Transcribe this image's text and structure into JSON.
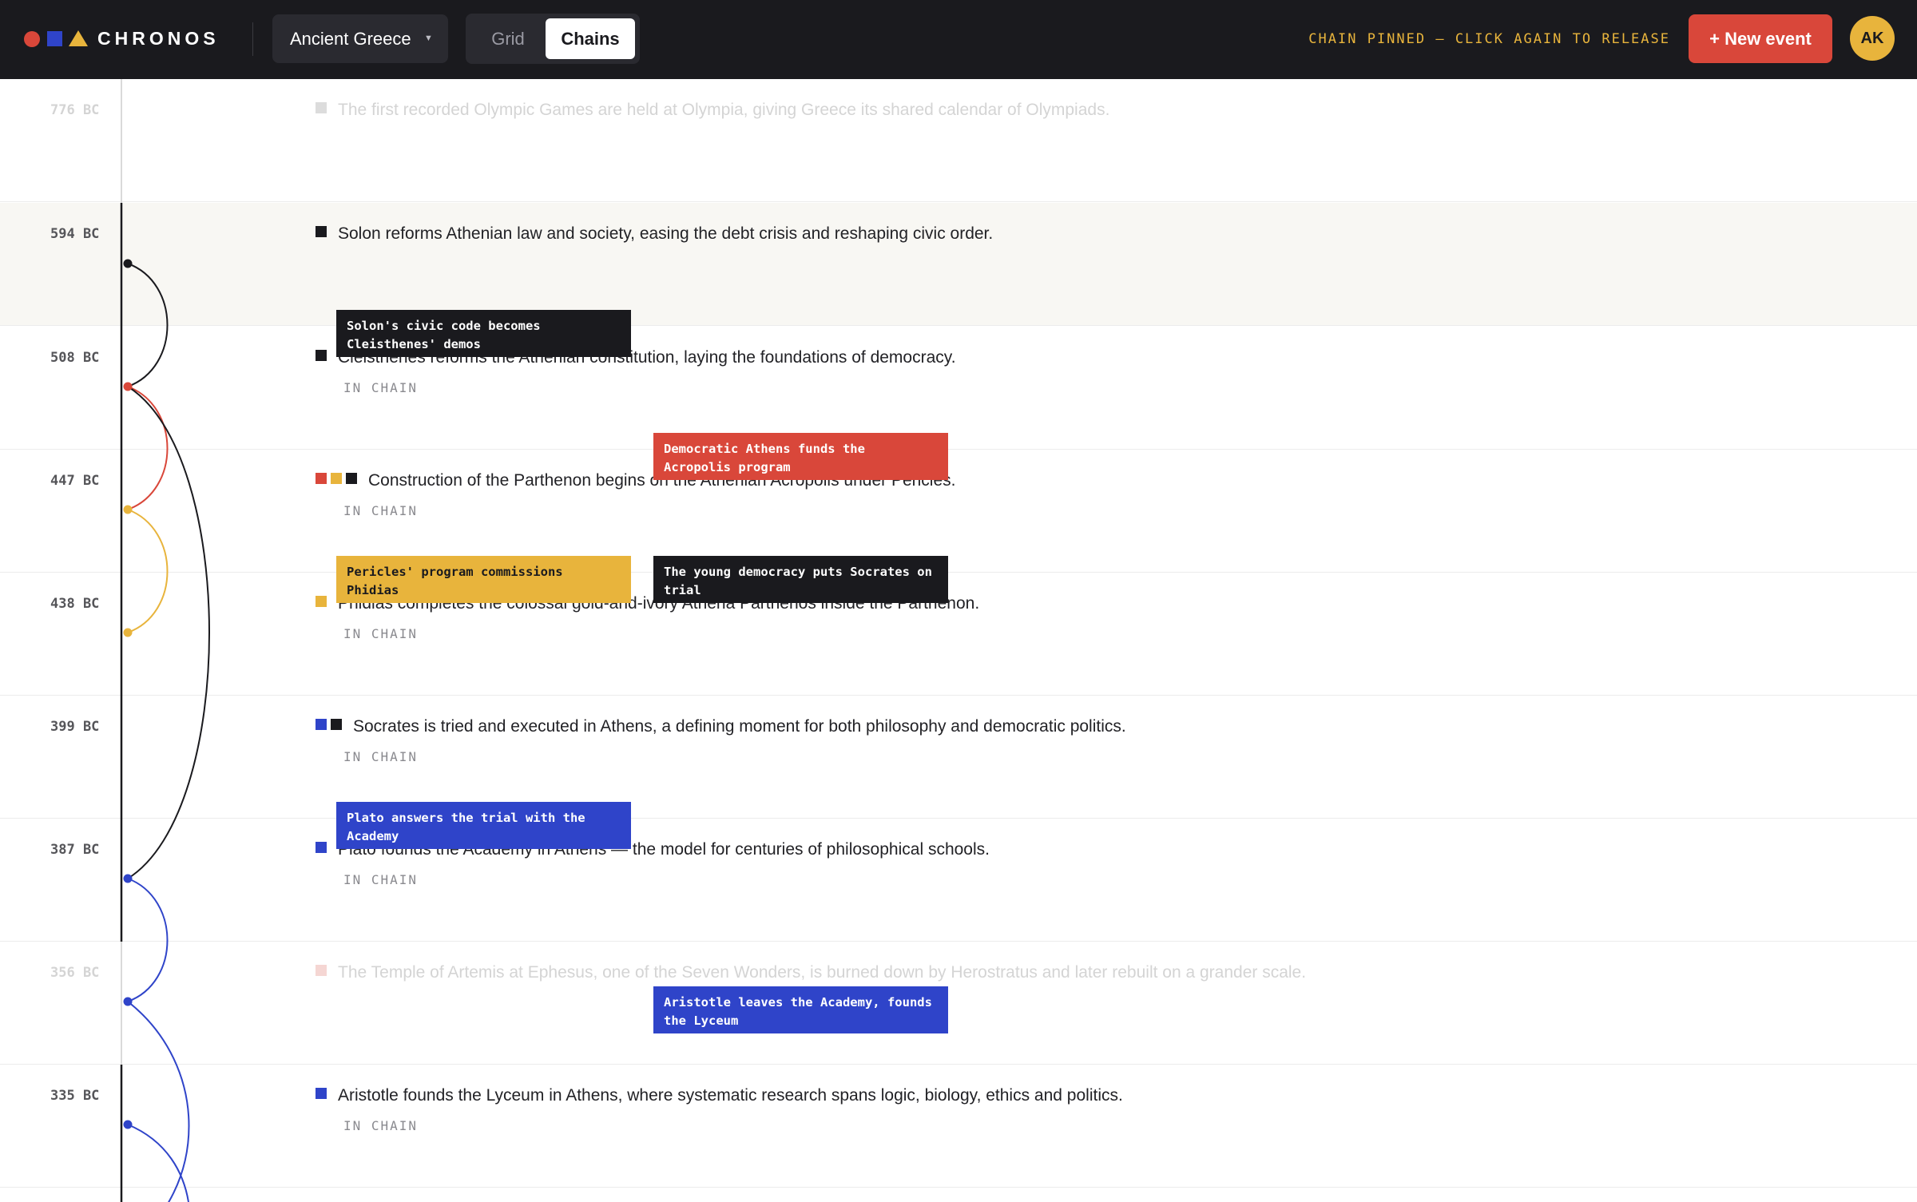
{
  "header": {
    "brand": "CHRONOS",
    "project": "Ancient Greece",
    "tabs": {
      "grid": "Grid",
      "chains": "Chains"
    },
    "status": "CHAIN PINNED — CLICK AGAIN TO RELEASE",
    "new_event": "+ New event",
    "avatar_initials": "AK"
  },
  "colors": {
    "red": "#d9473a",
    "yellow": "#e8b43c",
    "blue": "#2f44c9",
    "black": "#1a1a1e"
  },
  "events": [
    {
      "year": "776 BC",
      "text": "The first recorded Olympic Games are held at Olympia, giving Greece its shared calendar of Olympiads.",
      "in_chain": false
    },
    {
      "year": "594 BC",
      "text": "Solon reforms Athenian law and society, easing the debt crisis and reshaping civic order.",
      "in_chain": false
    },
    {
      "year": "508 BC",
      "text": "Cleisthenes reforms the Athenian constitution, laying the foundations of democracy.",
      "in_chain": true,
      "chain_label": "IN CHAIN"
    },
    {
      "year": "447 BC",
      "text": "Construction of the Parthenon begins on the Athenian Acropolis under Pericles.",
      "in_chain": true,
      "chain_label": "IN CHAIN"
    },
    {
      "year": "438 BC",
      "text": "Phidias completes the colossal gold-and-ivory Athena Parthenos inside the Parthenon.",
      "in_chain": true,
      "chain_label": "IN CHAIN"
    },
    {
      "year": "399 BC",
      "text": "Socrates is tried and executed in Athens, a defining moment for both philosophy and democratic politics.",
      "in_chain": true,
      "chain_label": "IN CHAIN"
    },
    {
      "year": "387 BC",
      "text": "Plato founds the Academy in Athens — the model for centuries of philosophical schools.",
      "in_chain": true,
      "chain_label": "IN CHAIN"
    },
    {
      "year": "356 BC",
      "text": "The Temple of Artemis at Ephesus, one of the Seven Wonders, is burned down by Herostratus and later rebuilt on a grander scale.",
      "in_chain": false
    },
    {
      "year": "335 BC",
      "text": "Aristotle founds the Lyceum in Athens, where systematic research spans logic, biology, ethics and politics.",
      "in_chain": true,
      "chain_label": "IN CHAIN"
    }
  ],
  "links": [
    {
      "text": "Solon's civic code becomes Cleisthenes' demos",
      "color": "black"
    },
    {
      "text": "Democratic Athens funds the Acropolis program",
      "color": "red"
    },
    {
      "text": "Pericles' program commissions Phidias",
      "color": "yellow"
    },
    {
      "text": "The young democracy puts Socrates on trial",
      "color": "black"
    },
    {
      "text": "Plato answers the trial with the Academy",
      "color": "blue"
    },
    {
      "text": "Aristotle leaves the Academy, founds the Lyceum",
      "color": "blue"
    }
  ]
}
